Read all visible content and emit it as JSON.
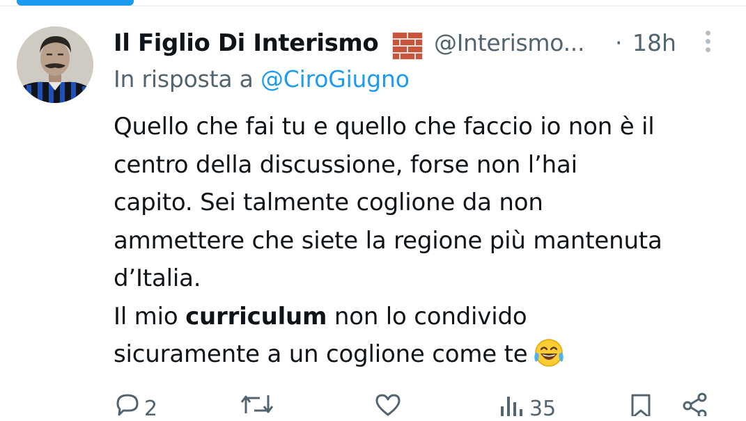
{
  "tweet": {
    "author": {
      "display_name": "Il Figlio Di Interismo",
      "name_emoji": "brick-emoji",
      "handle": "@Interismo...",
      "avatar": "avatar-portrait-blue-black-striped-shirt"
    },
    "separator": "·",
    "time": "18h",
    "reply_prefix": "In risposta a",
    "reply_to": "@CiroGiugno",
    "body": {
      "line1": "Quello che fai tu e quello che faccio io non è il",
      "line2": "centro della discussione, forse non l’hai",
      "line3": "capito. Sei talmente coglione da non",
      "line4": "ammettere che siete la regione più mantenuta",
      "line5": "d’Italia.",
      "line6_prefix": "Il mio ",
      "line6_bold": "curriculum",
      "line6_suffix": " non lo condivido",
      "line7": "sicuramente a un coglione come te",
      "line7_emoji": "face-with-tears-of-joy-emoji"
    },
    "actions": {
      "reply": {
        "icon": "reply-icon",
        "count": "2"
      },
      "retweet": {
        "icon": "retweet-icon",
        "count": ""
      },
      "like": {
        "icon": "like-icon",
        "count": ""
      },
      "views": {
        "icon": "views-icon",
        "count": "35"
      },
      "bookmark": {
        "icon": "bookmark-icon"
      },
      "share": {
        "icon": "share-icon"
      }
    }
  },
  "colors": {
    "text": "#0f1419",
    "secondary": "#536471",
    "link": "#1d9bf0",
    "divider": "#e6e9ec"
  }
}
